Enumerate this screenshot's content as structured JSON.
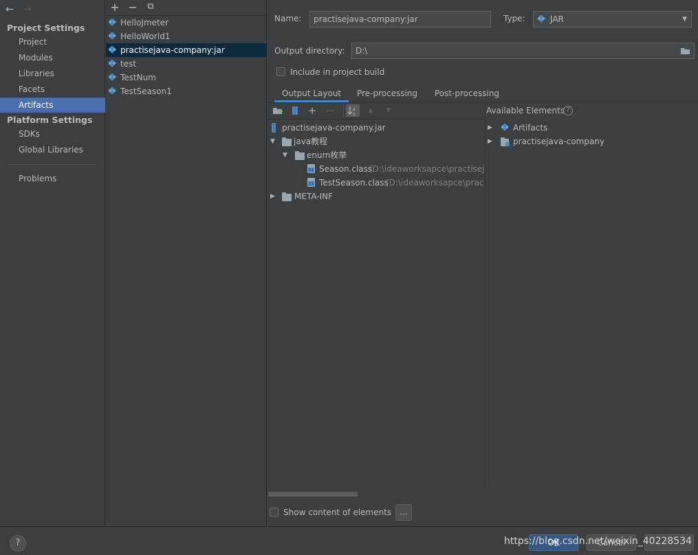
{
  "nav": {
    "back": "←",
    "forward": "→",
    "project_settings_header": "Project Settings",
    "project_items": [
      "Project",
      "Modules",
      "Libraries",
      "Facets",
      "Artifacts"
    ],
    "selected": "Artifacts",
    "platform_settings_header": "Platform Settings",
    "platform_items": [
      "SDKs",
      "Global Libraries"
    ],
    "problems": "Problems"
  },
  "artifacts_toolbar": {
    "add": "+",
    "remove": "−",
    "copy": "⧉"
  },
  "artifacts": [
    "HelloJmeter",
    "HelloWorld1",
    "practisejava-company:jar",
    "test",
    "TestNum",
    "TestSeason1"
  ],
  "selected_artifact": "practisejava-company:jar",
  "form": {
    "name_label": "Name:",
    "name_value": "practisejava-company:jar",
    "type_label": "Type:",
    "type_value": "JAR",
    "output_dir_label": "Output directory:",
    "output_dir_value": "D:\\",
    "include_build_label": "Include in project build",
    "include_build_checked": false
  },
  "tabs": [
    "Output Layout",
    "Pre-processing",
    "Post-processing"
  ],
  "active_tab": "Output Layout",
  "layout_tree": {
    "root": "practisejava-company.jar",
    "folder1": "java教程",
    "folder1_child": "enum枚举",
    "file1_name": "Season.class",
    "file1_path": " (D:\\ideaworksapce\\practisej",
    "file2_name": "TestSeason.class",
    "file2_path": " (D:\\ideaworksapce\\prac",
    "folder2": "META-INF"
  },
  "available": {
    "header": "Available Elements",
    "items": [
      "Artifacts",
      "practisejava-company"
    ]
  },
  "show_content_label": "Show content of elements",
  "ellipsis_button": "...",
  "bottom": {
    "help": "?",
    "ok": "OK",
    "cancel": "Cancel",
    "watermark": "https://blog.csdn.net/weixin_40228534"
  }
}
